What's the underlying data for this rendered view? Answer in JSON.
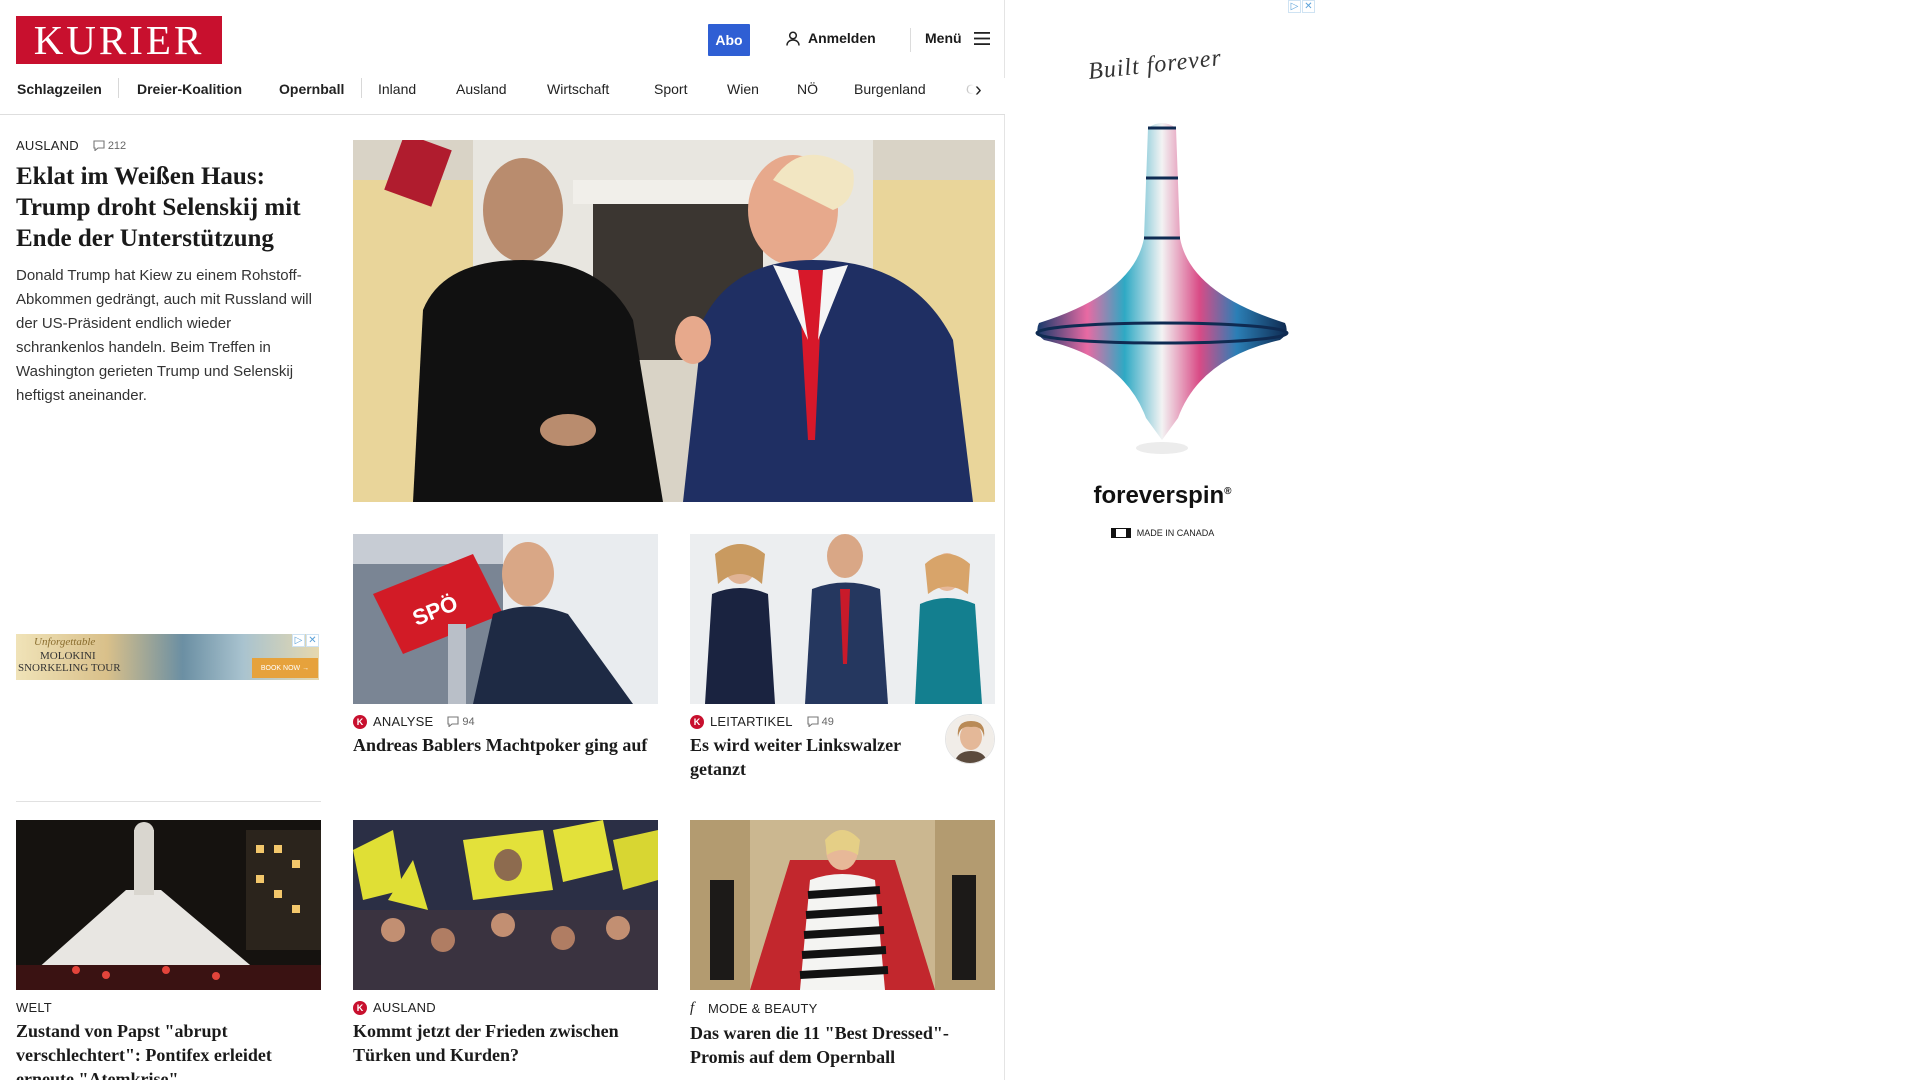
{
  "header": {
    "logo_text": "KURIER",
    "abo_label": "Abo",
    "login_label": "Anmelden",
    "menu_label": "Menü"
  },
  "nav": {
    "items": [
      "Schlagzeilen",
      "Dreier-Koalition",
      "Opernball",
      "Inland",
      "Ausland",
      "Wirtschaft",
      "Sport",
      "Wien",
      "NÖ",
      "Burgenland",
      "Oö"
    ]
  },
  "lead": {
    "category": "AUSLAND",
    "comments": "212",
    "headline": "Eklat im Weißen Haus: Trump droht Selenskij mit Ende der Unterstützung",
    "teaser": "Donald Trump hat Kiew zu einem Rohstoff-Abkommen gedrängt, auch mit Russland will der US-Präsident endlich wieder schrankenlos handeln. Beim Treffen in Washington gerieten Trump und Selenskij heftigst aneinander."
  },
  "cards": [
    {
      "badge": "K",
      "category": "ANALYSE",
      "comments": "94",
      "headline": "Andreas Bablers Machtpoker ging auf"
    },
    {
      "badge": "K",
      "category": "LEITARTIKEL",
      "comments": "49",
      "headline": "Es wird weiter Linkswalzer getanzt"
    },
    {
      "badge": "",
      "category": "WELT",
      "comments": "",
      "headline": "Zustand von Papst \"abrupt verschlechtert\": Pontifex erleidet erneute \"Atemkrise\""
    },
    {
      "badge": "K",
      "category": "AUSLAND",
      "comments": "",
      "headline": "Kommt jetzt der Frieden zwischen Türken und Kurden?"
    },
    {
      "badge": "f",
      "category": "MODE & BEAUTY",
      "comments": "",
      "headline": "Das waren die 11 \"Best Dressed\"-Promis auf dem Opernball"
    }
  ],
  "small_ad": {
    "script": "Unforgettable",
    "line1": "MOLOKINI",
    "line2": "SNORKELING TOUR",
    "cta": "BOOK NOW →"
  },
  "right_ad": {
    "script": "Built forever",
    "brand": "foreverspin",
    "made_in": "MADE IN CANADA"
  },
  "colors": {
    "brand_red": "#c8102e",
    "abo_blue": "#2f5fd4"
  }
}
